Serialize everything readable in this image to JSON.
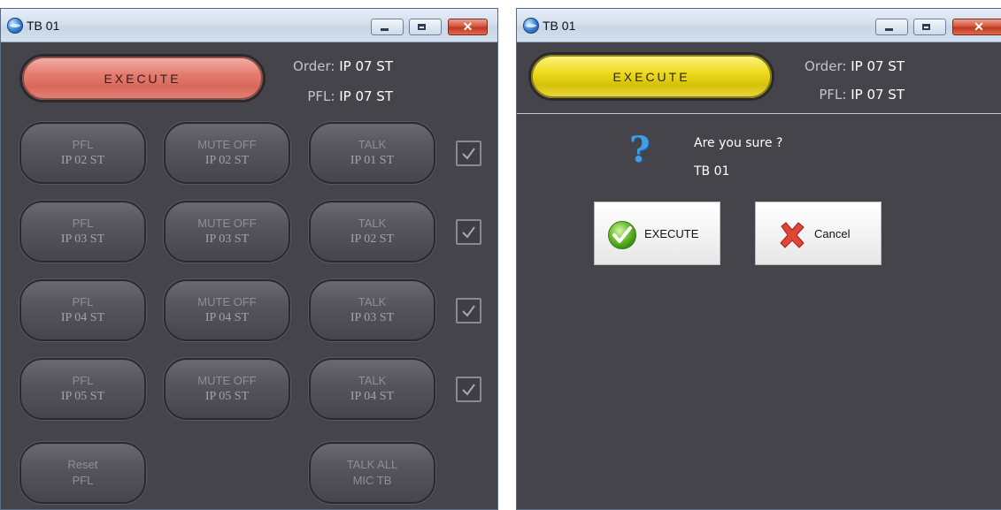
{
  "windows": [
    {
      "title": "TB 01",
      "execute_label": "EXECUTE",
      "order_label": "Order:",
      "order_value": "IP 07 ST",
      "pfl_label": "PFL:",
      "pfl_value": "IP 07 ST",
      "rows": [
        {
          "pfl": [
            "PFL",
            "IP 02 ST"
          ],
          "mute": [
            "MUTE OFF",
            "IP 02 ST"
          ],
          "talk": [
            "TALK",
            "IP 01 ST"
          ],
          "checked": true
        },
        {
          "pfl": [
            "PFL",
            "IP 03 ST"
          ],
          "mute": [
            "MUTE OFF",
            "IP 03 ST"
          ],
          "talk": [
            "TALK",
            "IP 02 ST"
          ],
          "checked": true
        },
        {
          "pfl": [
            "PFL",
            "IP 04 ST"
          ],
          "mute": [
            "MUTE OFF",
            "IP 04 ST"
          ],
          "talk": [
            "TALK",
            "IP 03 ST"
          ],
          "checked": true
        },
        {
          "pfl": [
            "PFL",
            "IP 05 ST"
          ],
          "mute": [
            "MUTE OFF",
            "IP 05 ST"
          ],
          "talk": [
            "TALK",
            "IP 04 ST"
          ],
          "checked": true
        }
      ],
      "reset": [
        "Reset",
        "PFL"
      ],
      "talk_all": [
        "TALK ALL",
        "MIC TB"
      ]
    },
    {
      "title": "TB 01",
      "execute_label": "EXECUTE",
      "order_label": "Order:",
      "order_value": "IP 07 ST",
      "pfl_label": "PFL:",
      "pfl_value": "IP 07 ST",
      "dialog": {
        "question": "Are you sure ?",
        "target": "TB 01",
        "confirm_label": "EXECUTE",
        "cancel_label": "Cancel"
      }
    }
  ],
  "colors": {
    "panel_bg": "#46444b",
    "execute_armed": "#e57c70",
    "execute_confirm": "#eedc20"
  }
}
